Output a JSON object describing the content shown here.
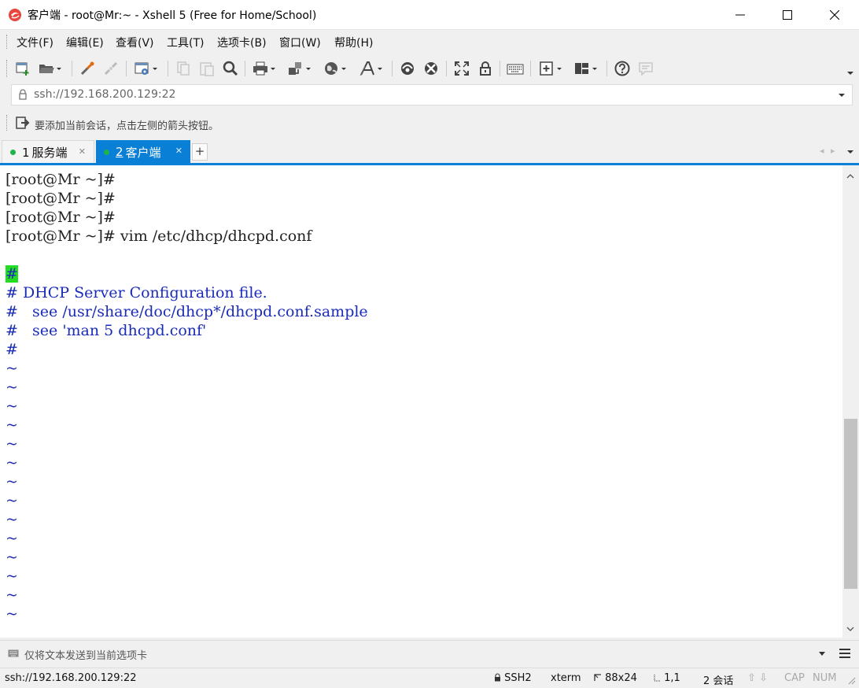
{
  "window": {
    "title": "客户端 - root@Mr:~ - Xshell 5 (Free for Home/School)"
  },
  "menu": [
    "文件(F)",
    "编辑(E)",
    "查看(V)",
    "工具(T)",
    "选项卡(B)",
    "窗口(W)",
    "帮助(H)"
  ],
  "toolbar_icons": [
    "new-session-icon",
    "open-folder-icon",
    "reconnect-icon",
    "disconnect-icon",
    "properties-icon",
    "copy-icon",
    "paste-icon",
    "find-icon",
    "print-icon",
    "transfer-icon",
    "globe-icon",
    "font-icon",
    "xftp-icon",
    "xmanager-icon",
    "fullscreen-icon",
    "lock-icon",
    "keyboard-icon",
    "new-tab-icon",
    "layout-icon",
    "help-icon",
    "chat-icon"
  ],
  "address": {
    "value": "ssh://192.168.200.129:22"
  },
  "links_hint": "要添加当前会话，点击左侧的箭头按钮。",
  "tabs": [
    {
      "number": "1",
      "label": "服务端",
      "active": false
    },
    {
      "number": "2",
      "label": "客户端",
      "active": true
    }
  ],
  "terminal": {
    "lines": [
      "[root@Mr ~]#",
      "[root@Mr ~]#",
      "[root@Mr ~]#",
      "[root@Mr ~]# vim /etc/dhcp/dhcpd.conf",
      "",
      "#",
      "# DHCP Server Configuration file.",
      "#   see /usr/share/doc/dhcp*/dhcpd.conf.sample",
      "#   see 'man 5 dhcpd.conf'",
      "#",
      "~",
      "~",
      "~",
      "~",
      "~",
      "~",
      "~",
      "~",
      "~",
      "~",
      "~",
      "~",
      "~",
      "~"
    ],
    "colors": {
      "background": "#ffffff",
      "shell_text": "#222222",
      "vim_text": "#1a2bb8",
      "cursor": "#22dd22"
    }
  },
  "compose": {
    "placeholder": "仅将文本发送到当前选项卡"
  },
  "status": {
    "connection": "ssh://192.168.200.129:22",
    "protocol": "SSH2",
    "terminal_type": "xterm",
    "size": "88x24",
    "cursor_pos": "1,1",
    "sessions": "2 会话",
    "cap": "CAP",
    "num": "NUM"
  },
  "accent_color": "#0a7fd6"
}
